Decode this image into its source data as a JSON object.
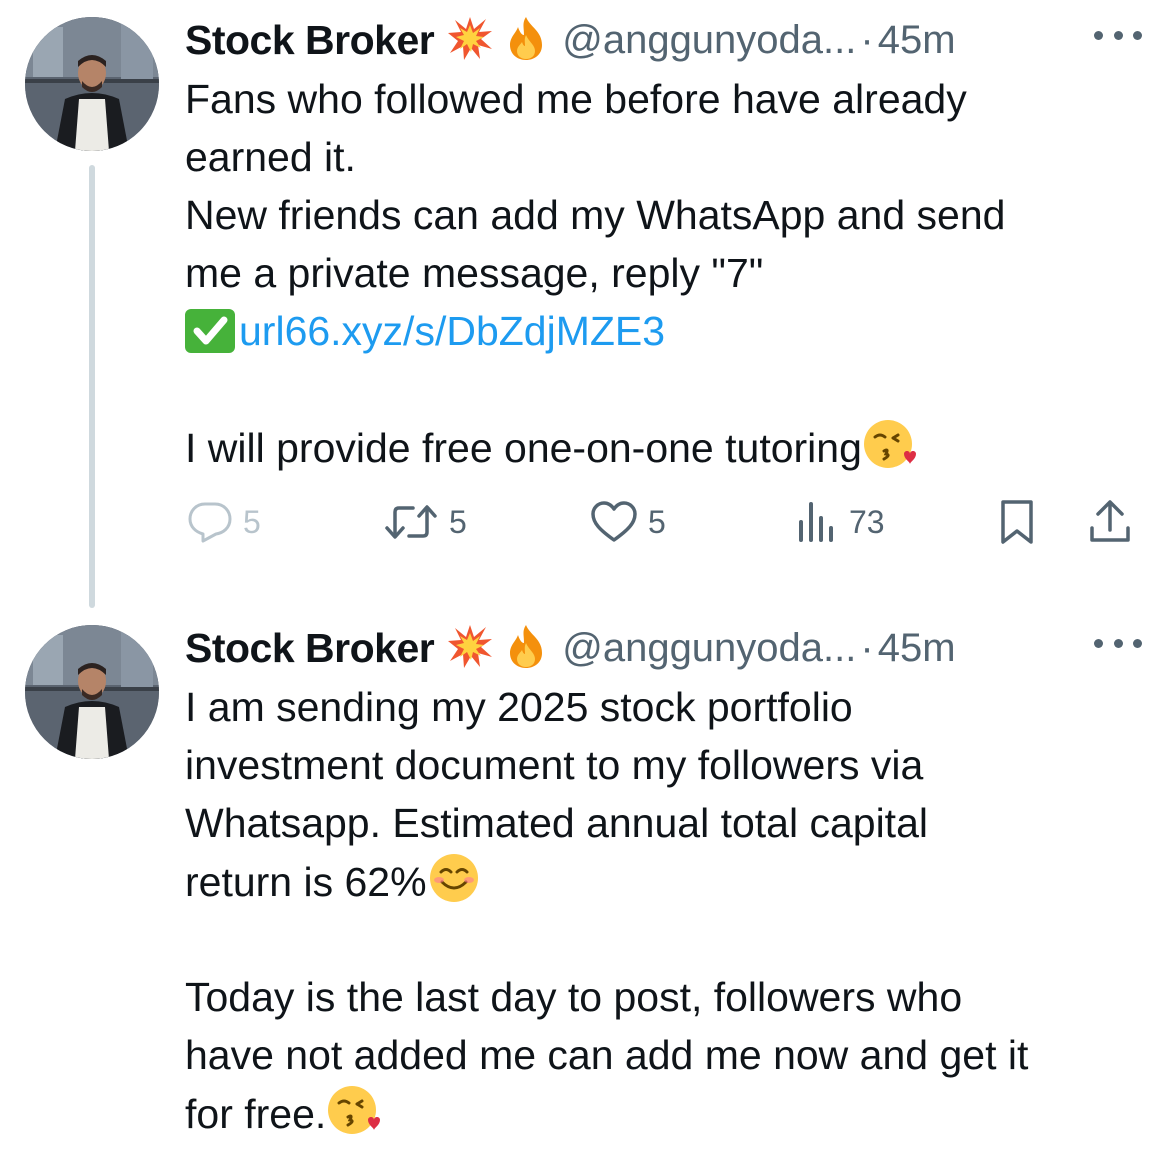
{
  "tweets": [
    {
      "author": {
        "name": "Stock Broker",
        "badges": [
          "collision-emoji",
          "fire-emoji"
        ],
        "handle": "@anggunyoda...",
        "separator": "·",
        "time": "45m"
      },
      "lines": [
        "Fans who followed me before have already",
        "earned it.",
        "New friends can add my WhatsApp and send",
        "me a private message, reply \"7\"",
        "url66.xyz/s/DbZdjMZE3",
        "",
        "I will provide free one-on-one tutoring"
      ],
      "stats": {
        "replies": "5",
        "reposts": "5",
        "likes": "5",
        "views": "73"
      }
    },
    {
      "author": {
        "name": "Stock Broker",
        "badges": [
          "collision-emoji",
          "fire-emoji"
        ],
        "handle": "@anggunyoda...",
        "separator": "·",
        "time": "45m"
      },
      "lines": [
        "I am sending my 2025 stock portfolio",
        "investment document to my followers via",
        "Whatsapp. Estimated annual total capital",
        "return is 62%",
        "",
        "Today is the last day to post, followers who",
        "have not added me can add me now and get it",
        "for free."
      ]
    }
  ],
  "colors": {
    "text": "#0f1419",
    "secondary": "#536471",
    "link": "#1d9bf0",
    "thread_line": "#cfd9de"
  }
}
